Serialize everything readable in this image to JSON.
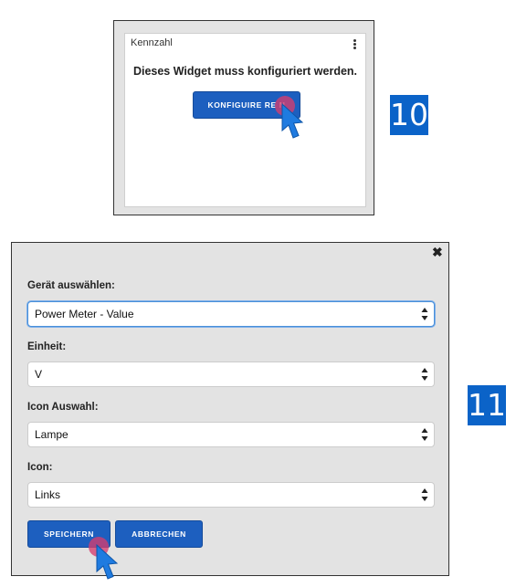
{
  "widget": {
    "title": "Kennzahl",
    "menu_icon": "kebab-menu-icon",
    "message": "Dieses Widget muss konfiguriert werden.",
    "configure_label": "KONFIGUIRE RE N"
  },
  "steps": {
    "first": "10",
    "second": "11"
  },
  "dialog": {
    "close_icon": "close-icon",
    "fields": {
      "device": {
        "label": "Gerät auswählen:",
        "value": "Power Meter - Value"
      },
      "unit": {
        "label": "Einheit:",
        "value": "V"
      },
      "icon_choice": {
        "label": "Icon Auswahl:",
        "value": "Lampe"
      },
      "icon": {
        "label": "Icon:",
        "value": "Links"
      }
    },
    "save_label": "SPEICHERN",
    "cancel_label": "ABBRECHEN"
  },
  "colors": {
    "button_blue": "#1d5fbf",
    "badge_blue": "#0b63c8",
    "click_marker": "#d63c6e",
    "cursor": "#1f7be0",
    "panel_gray": "#e3e3e3"
  }
}
